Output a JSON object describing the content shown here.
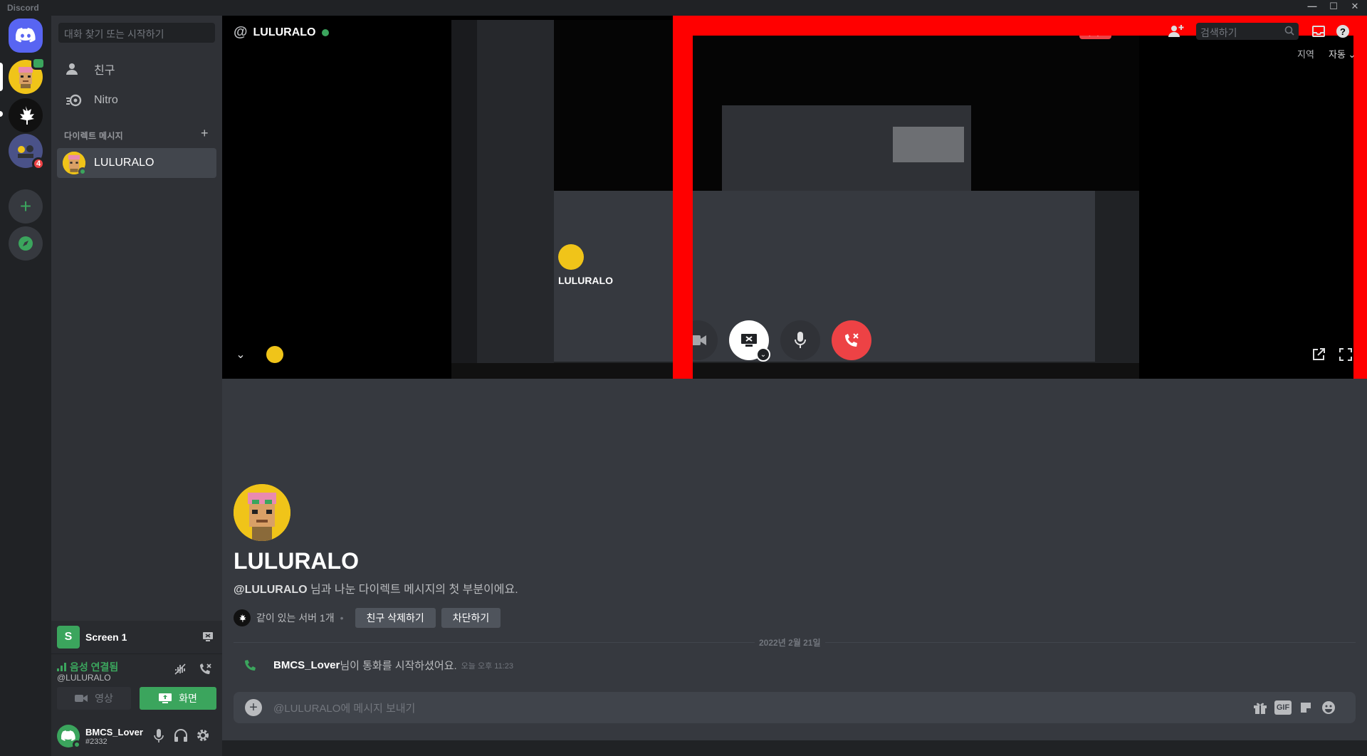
{
  "window": {
    "title": "Discord"
  },
  "guilds": {
    "items": [
      {
        "name": "home"
      },
      {
        "name": "server-1"
      },
      {
        "name": "server-2"
      },
      {
        "name": "server-3",
        "badge": "4"
      }
    ]
  },
  "sidebar": {
    "search_placeholder": "대화 찾기 또는 시작하기",
    "nav": [
      {
        "label": "친구"
      },
      {
        "label": "Nitro"
      }
    ],
    "dm_header": "다이렉트 메시지",
    "dm_items": [
      {
        "name": "LULURALO"
      }
    ]
  },
  "stream_panel": {
    "letter": "S",
    "name": "Screen 1"
  },
  "voice_panel": {
    "status": "음성 연결됨",
    "channel": "@LULURALO",
    "video_label": "영상",
    "screen_label": "화면"
  },
  "user": {
    "name": "BMCS_Lover",
    "tag": "#2332"
  },
  "call": {
    "header_name": "LULURALO",
    "live_badge": "라이브",
    "search_placeholder": "검색하기",
    "region_label": "지역",
    "region_value": "자동"
  },
  "chat": {
    "name": "LULURALO",
    "intro_handle": "@LULURALO",
    "intro_text": " 님과 나눈 다이렉트 메시지의 첫 부분이에요.",
    "mutual": "같이 있는 서버 1개",
    "remove_friend": "친구 삭제하기",
    "block": "차단하기",
    "date": "2022년 2월 21일",
    "call_user": "BMCS_Lover",
    "call_text": " 님이 통화를 시작하셨어요.",
    "call_time": "오늘 오후 11:23",
    "composer_placeholder": "@LULURALO에 메시지 보내기",
    "gif_label": "GIF"
  },
  "colors": {
    "brand": "#5865f2",
    "green": "#3ba55d",
    "red": "#ed4245",
    "highlight": "#ff0000"
  }
}
